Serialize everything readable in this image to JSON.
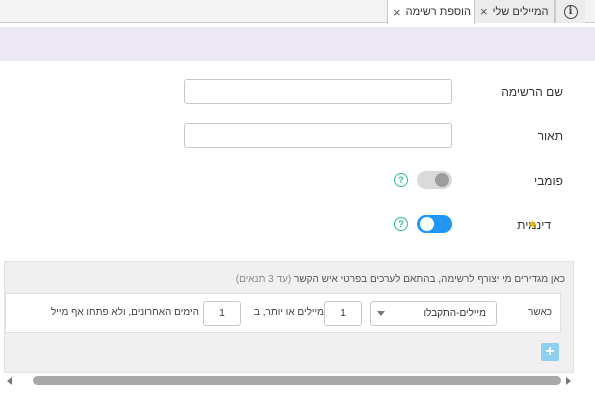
{
  "tabs": [
    {
      "label": "הוספת רשימה",
      "active": true
    },
    {
      "label": "המיילים שלי",
      "active": false
    }
  ],
  "home_icon": "info-icon",
  "form": {
    "list_name_label": "שם הרשימה",
    "list_name_value": "",
    "description_label": "תאור",
    "description_value": "",
    "public_label": "פומבי",
    "public_on": false,
    "dynamic_label": "דינמית",
    "dynamic_on": true,
    "help_icon_glyph": "?",
    "sparkle_icon": "sparkle-icon"
  },
  "conditions": {
    "title": "כאן מגדירים מי יצורף לרשימה, בהתאם לערכים בפרטי איש הקשר",
    "hint": "(עד 3 תנאים)",
    "row": {
      "when_label": "כאשר",
      "select_value": "מיילים-התקבלו",
      "count_value": "1",
      "count_suffix": "מיילים או יותר, ב",
      "days_value": "1",
      "days_suffix": "הימים האחרונים, ולא פתחו אף מייל"
    },
    "add_label": "+"
  },
  "colors": {
    "accent": "#2196f3",
    "help": "#2fbf8a",
    "band": "#ebe7f4"
  }
}
